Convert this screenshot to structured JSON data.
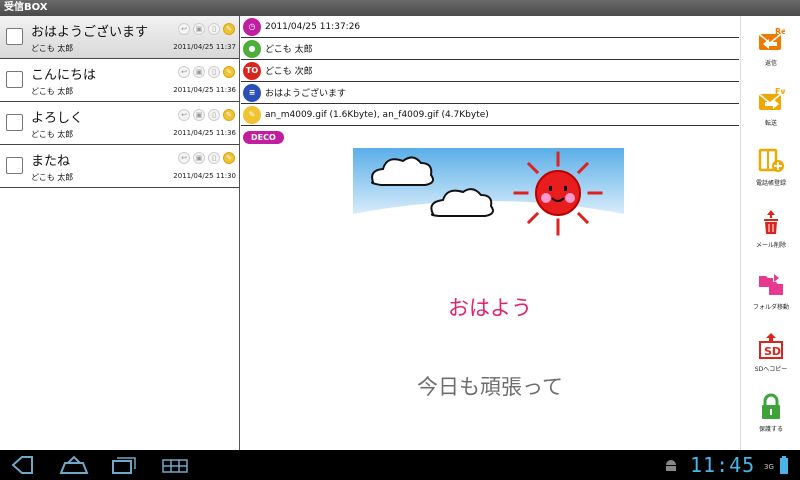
{
  "titlebar": {
    "title": "受信BOX"
  },
  "mail_list": [
    {
      "subject": "おはようございます",
      "sender": "どこも 太郎",
      "date": "2011/04/25 11:37",
      "selected": true
    },
    {
      "subject": "こんにちは",
      "sender": "どこも 太郎",
      "date": "2011/04/25 11:36",
      "selected": false
    },
    {
      "subject": "よろしく",
      "sender": "どこも 太郎",
      "date": "2011/04/25 11:36",
      "selected": false
    },
    {
      "subject": "またね",
      "sender": "どこも 太郎",
      "date": "2011/04/25 11:30",
      "selected": false
    }
  ],
  "detail": {
    "datetime": "2011/04/25 11:37:26",
    "from": "どこも 太郎",
    "to_badge": "TO",
    "to": "どこも 次郎",
    "subject": "おはようございます",
    "attachments": "an_m4009.gif (1.6Kbyte), an_f4009.gif (4.7Kbyte)",
    "deco_label": "DECO",
    "message_line1": "おはよう",
    "message_line2": "今日も頑張って"
  },
  "actions": {
    "reply": {
      "label": "返信",
      "badge": "Re"
    },
    "forward": {
      "label": "転送",
      "badge": "Fw"
    },
    "add_contact": {
      "label": "電話帳登録"
    },
    "delete": {
      "label": "メール削除"
    },
    "move_folder": {
      "label": "フォルダ移動"
    },
    "sd_copy": {
      "label": "SDへコピー",
      "badge": "SD"
    },
    "protect": {
      "label": "保護する"
    }
  },
  "statusbar": {
    "clock": "11:45",
    "network": "3G"
  },
  "colors": {
    "accent_orange": "#f07a00",
    "accent_magenta": "#c21ea0",
    "message_pink": "#e0246e",
    "clock_blue": "#4ab3e8"
  }
}
